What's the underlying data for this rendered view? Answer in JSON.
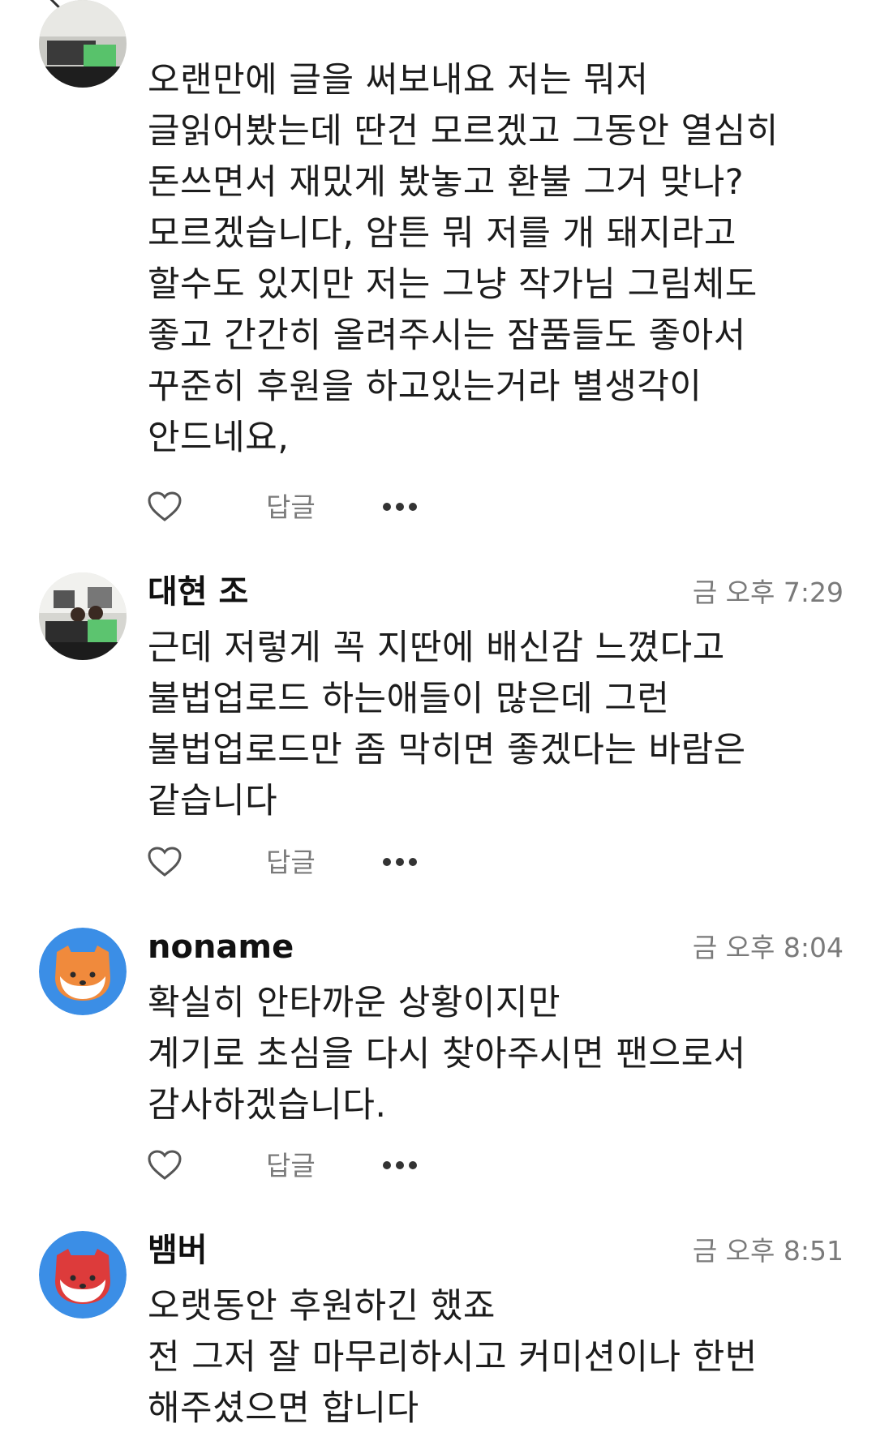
{
  "comments": [
    {
      "author": "",
      "time": "",
      "lines": [
        "오랜만에 글을 써보내요 저는 뭐저",
        "글읽어봤는데 딴건 모르겠고 그동안 열심히",
        "돈쓰면서 재밌게 봤놓고 환불 그거 맞나?",
        "모르겠습니다, 암튼 뭐 저를 개 돼지라고",
        "할수도 있지만 저는 그냥 작가님 그림체도",
        "좋고 간간히 올려주시는 잠품들도 좋아서",
        "꾸준히 후원을 하고있는거라 별생각이",
        "안드네요,"
      ],
      "reply_label": "답글",
      "avatar_icon": "photo-avatar-icon"
    },
    {
      "author": "대현 조",
      "time": "금 오후 7:29",
      "lines": [
        "근데 저렇게 꼭 지딴에 배신감 느꼈다고",
        "불법업로드 하는애들이 많은데 그런",
        "불법업로드만 좀 막히면 좋겠다는 바람은",
        "같습니다"
      ],
      "reply_label": "답글",
      "avatar_icon": "photo-avatar-icon"
    },
    {
      "author": "noname",
      "time": "금 오후 8:04",
      "lines": [
        "확실히 안타까운 상황이지만",
        "계기로 초심을 다시 찾아주시면 팬으로서",
        "감사하겠습니다."
      ],
      "reply_label": "답글",
      "avatar_icon": "orange-fox-avatar-icon"
    },
    {
      "author": "뱀버",
      "time": "금 오후 8:51",
      "lines": [
        "오랫동안 후원하긴 했죠",
        "전 그저 잘 마무리하시고 커미션이나 한번",
        "해주셨으면 합니다"
      ],
      "reply_label": "",
      "avatar_icon": "red-fox-avatar-icon"
    }
  ],
  "colors": {
    "avatar_blue": "#3b8ee6",
    "fox_orange": "#f08a3c",
    "fox_red": "#dd3b3b",
    "meta_gray": "#7a7a7a"
  },
  "icons": [
    "back-arrow-icon",
    "heart-icon",
    "more-dots-icon"
  ]
}
